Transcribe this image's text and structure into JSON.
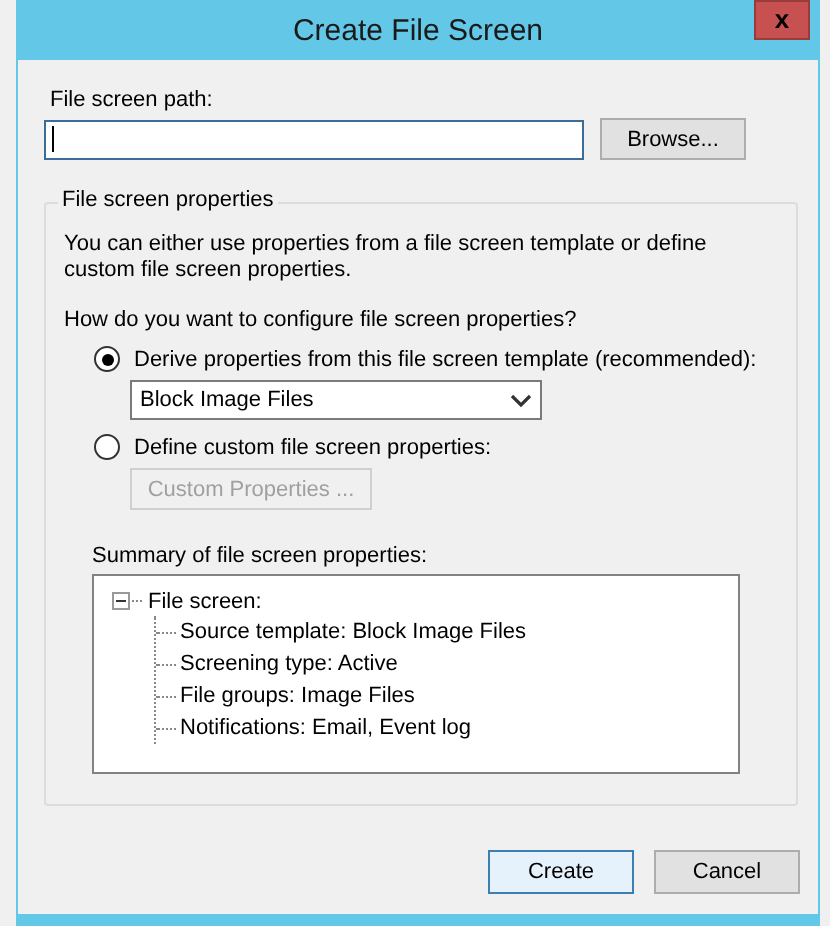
{
  "window": {
    "title": "Create File Screen",
    "close": "x"
  },
  "path": {
    "label": "File screen path:",
    "browse": "Browse..."
  },
  "properties": {
    "title": "File screen properties",
    "description": "You can either use properties from a file screen template or define custom file screen properties.",
    "question": "How do you want to configure file screen properties?",
    "options": [
      {
        "label": "Derive properties from this file screen template (recommended):",
        "selected": true,
        "kind": "template",
        "template": "Block Image Files"
      },
      {
        "label": "Define custom file screen properties:",
        "selected": false,
        "kind": "custom",
        "button": "Custom Properties ...",
        "disabled": true
      }
    ],
    "summary": {
      "label": "Summary of file screen properties:",
      "tree": [
        {
          "label": "File screen:",
          "expanded": true,
          "children": [
            {
              "label": "Source template: Block Image Files"
            },
            {
              "label": "Screening type: Active"
            },
            {
              "label": "File groups: Image Files"
            },
            {
              "label": "Notifications: Email, Event log"
            }
          ]
        }
      ]
    }
  },
  "buttons": [
    {
      "label": "Create",
      "default": true
    },
    {
      "label": "Cancel",
      "default": false
    }
  ]
}
